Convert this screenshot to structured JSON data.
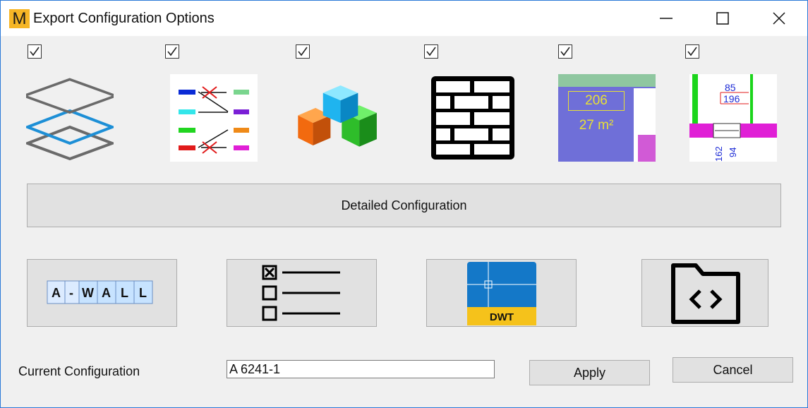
{
  "window": {
    "title": "Export Configuration Options",
    "logo_letter": "M",
    "controls": [
      "minimize-icon",
      "maximize-icon",
      "close-icon"
    ]
  },
  "options": [
    {
      "name": "layers",
      "checked": true,
      "icon": "layers-icon"
    },
    {
      "name": "layer-mapping",
      "checked": true,
      "icon": "layer-mapping-icon"
    },
    {
      "name": "blocks",
      "checked": true,
      "icon": "blocks-icon"
    },
    {
      "name": "hatch",
      "checked": true,
      "icon": "brick-hatch-icon"
    },
    {
      "name": "room-labels",
      "checked": true,
      "icon": "room-label-icon",
      "room_number": "206",
      "room_area": "27 m²"
    },
    {
      "name": "dimensions",
      "checked": true,
      "icon": "dimension-icon",
      "dims": [
        "85",
        "196",
        "162",
        "94"
      ]
    }
  ],
  "detailed_configuration_label": "Detailed Configuration",
  "tools": {
    "layer_name_letters": [
      "A",
      "-",
      "W",
      "A",
      "L",
      "L"
    ],
    "dwt_label": "DWT"
  },
  "current": {
    "label": "Current Configuration",
    "value": "A 6241-1"
  },
  "buttons": {
    "apply": "Apply",
    "cancel": "Cancel"
  },
  "colors": {
    "accent": "#2b79d8",
    "logo": "#f6b626",
    "button_face": "#e1e1e1"
  }
}
